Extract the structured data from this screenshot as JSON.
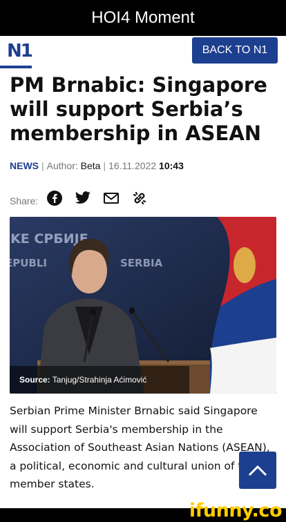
{
  "meme": {
    "caption": "HOI4 Moment",
    "watermark": "ifunny.co"
  },
  "navbar": {
    "logo_text": "N1",
    "back_button": "BACK TO N1"
  },
  "article": {
    "headline": "PM Brnabic: Singapore will support Serbia’s membership in ASEAN",
    "category": "NEWS",
    "separator": "|",
    "author_label": "Author:",
    "author": "Beta",
    "separator2": "|",
    "date": "16.11.2022",
    "time": "10:43",
    "share_label": "Share:",
    "share_icons": [
      "facebook-icon",
      "twitter-icon",
      "email-icon",
      "link-icon"
    ],
    "photo": {
      "backdrop_text_line1": "IKE CPБИJE",
      "backdrop_text_line2": "EPUBLI",
      "backdrop_text_line3": "SERBIA",
      "source_label": "Source:",
      "source": "Tanjug/Strahinja Aćimović"
    },
    "body": "Serbian Prime Minister Brnabic said Singapore will support Serbia's membership in the Association of Southeast Asian Nations (ASEAN), a political, economic and cultural union of ten member states."
  },
  "colors": {
    "brand": "#1d3f8f",
    "watermark": "#ffcc00"
  }
}
